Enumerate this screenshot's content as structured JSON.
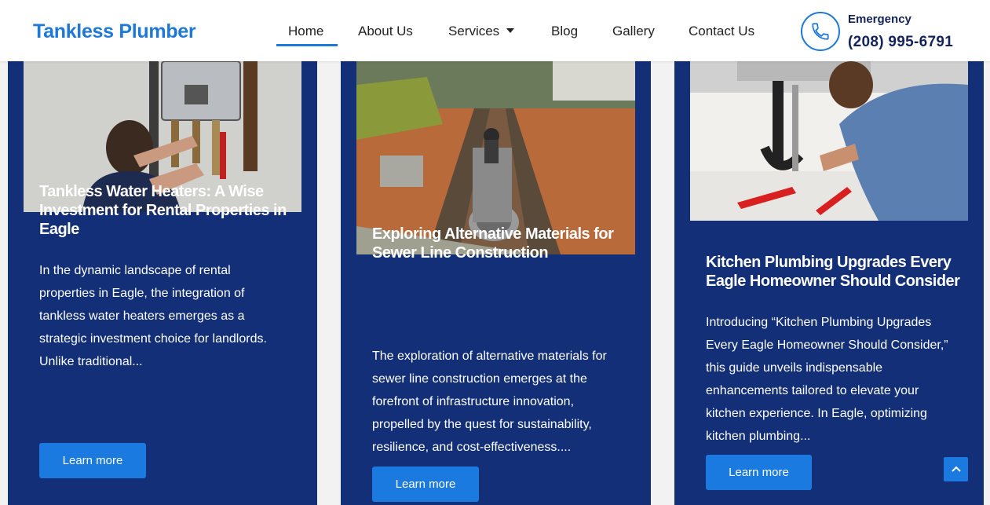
{
  "header": {
    "logo": "Tankless Plumber",
    "nav": [
      {
        "label": "Home"
      },
      {
        "label": "About Us"
      },
      {
        "label": "Services"
      },
      {
        "label": "Blog"
      },
      {
        "label": "Gallery"
      },
      {
        "label": "Contact Us"
      }
    ],
    "emergency_label": "Emergency",
    "phone": "(208) 995-6791"
  },
  "cards": [
    {
      "title": "Tankless Water Heaters: A Wise Investment for Rental Properties in Eagle",
      "excerpt": "In the dynamic landscape of rental properties in Eagle, the integration of tankless water heaters emerges as a strategic investment choice for landlords. Unlike traditional...",
      "button": "Learn more"
    },
    {
      "title": "Exploring Alternative Materials for Sewer Line Construction",
      "excerpt": "The exploration of alternative materials for sewer line construction emerges at the forefront of infrastructure innovation, propelled by the quest for sustainability, resilience, and cost-effectiveness....",
      "button": "Learn more"
    },
    {
      "title": "Kitchen Plumbing Upgrades Every Eagle Homeowner Should Consider",
      "excerpt": "Introducing “Kitchen Plumbing Upgrades Every Eagle Homeowner Should Consider,” this guide unveils indispensable enhancements tailored to elevate your kitchen experience. In Eagle, optimizing kitchen plumbing...",
      "button": "Learn more"
    }
  ],
  "colors": {
    "brand": "#1e78d8",
    "card_bg": "#122f77",
    "button": "#1a7ae0"
  },
  "icons": {
    "phone": "phone-icon",
    "scroll_top": "chevron-up-icon"
  }
}
